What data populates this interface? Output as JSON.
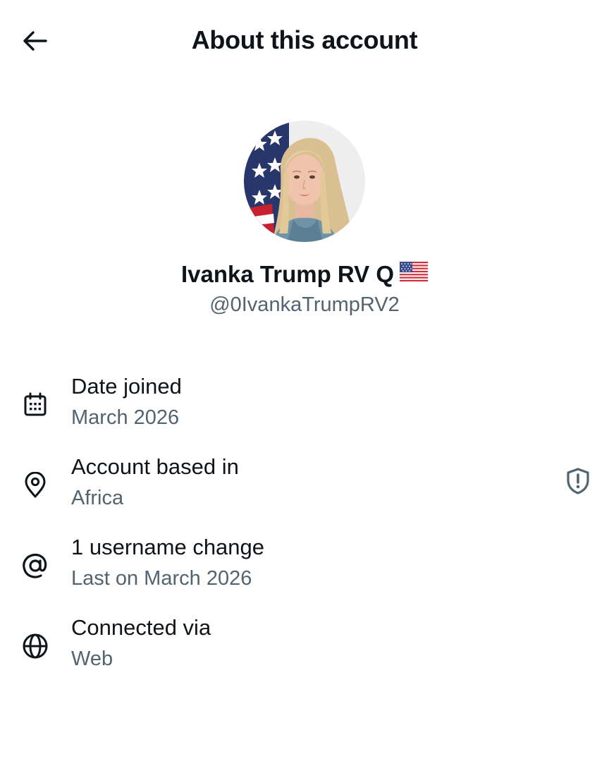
{
  "header": {
    "title": "About this account",
    "back_icon": "arrow-left-icon"
  },
  "profile": {
    "display_name": "Ivanka Trump RV Q",
    "flag_icon": "us-flag-icon",
    "handle": "@0IvankaTrumpRV2"
  },
  "info": [
    {
      "icon": "calendar-icon",
      "label": "Date joined",
      "value": "March 2026"
    },
    {
      "icon": "location-pin-icon",
      "label": "Account based in",
      "value": "Africa",
      "action_icon": "shield-alert-icon"
    },
    {
      "icon": "at-sign-icon",
      "label": "1 username change",
      "value": "Last on March 2026"
    },
    {
      "icon": "globe-icon",
      "label": "Connected via",
      "value": "Web"
    }
  ],
  "colors": {
    "text_primary": "#0f1419",
    "text_secondary": "#536471",
    "background": "#ffffff"
  }
}
